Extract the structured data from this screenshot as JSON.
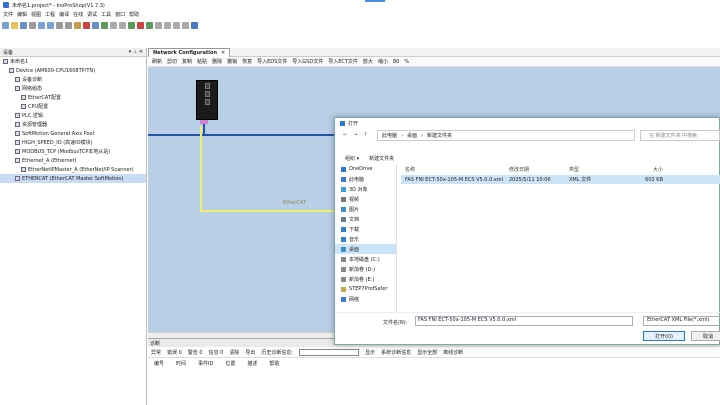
{
  "window": {
    "title": "未命名1.project* - InoProShop(V1.7.3)"
  },
  "menu": [
    "文件",
    "编辑",
    "视图",
    "工程",
    "编译",
    "在线",
    "调试",
    "工具",
    "窗口",
    "帮助"
  ],
  "left_panel": {
    "title": "设备",
    "pin": "▾ ⊥ ✕",
    "tree": [
      {
        "label": "未命名1",
        "indent": 0
      },
      {
        "label": "Device (AM600-CPU1608TP/TN)",
        "indent": 1
      },
      {
        "label": "设备诊断",
        "indent": 2
      },
      {
        "label": "网络组态",
        "indent": 2
      },
      {
        "label": "EtherCAT配置",
        "indent": 3
      },
      {
        "label": "CPU配置",
        "indent": 3
      },
      {
        "label": "PLC 逻辑",
        "indent": 2
      },
      {
        "label": "资源管理器",
        "indent": 2
      },
      {
        "label": "SoftMotion General Axis Pool",
        "indent": 2
      },
      {
        "label": "HIGH_SPEED_IO (高速IO模块)",
        "indent": 2
      },
      {
        "label": "MODBUS_TCP (ModbusTCP本地从站)",
        "indent": 2
      },
      {
        "label": "Ethernet_A (Ethernet)",
        "indent": 2
      },
      {
        "label": "EtherNetIPMaster_A (EtherNet/IP Scanner)",
        "indent": 3
      },
      {
        "label": "ETHERCAT (EtherCAT Master SoftMotion)",
        "indent": 2
      }
    ]
  },
  "tab": {
    "label": "Network Configuration"
  },
  "net_toolbar": [
    "刷新",
    "剪切",
    "复制",
    "粘贴",
    "删除",
    "撤销",
    "恢复",
    "导入EDS文件",
    "导入GSD文件",
    "导入ECT文件",
    "放大",
    "缩小",
    "80",
    "%"
  ],
  "canvas": {
    "ethercat_label": "EtherCAT"
  },
  "diag": {
    "title": "诊断",
    "filters": [
      "异常",
      "错误 0",
      "警告 0",
      "信息 0",
      "清除",
      "导出",
      "历史诊断信息:"
    ],
    "options": [
      "显示",
      "系统诊断信息",
      "显示全部",
      "离线诊断"
    ],
    "columns": [
      "编号",
      "时间",
      "事件ID",
      "位置",
      "描述",
      "帮助"
    ]
  },
  "dialog": {
    "title": "打开",
    "path": [
      "此电脑",
      "桌面",
      "新建文件夹"
    ],
    "search_placeholder": "在 新建文件夹 中搜索",
    "tools": [
      "组织 ▾",
      "新建文件夹"
    ],
    "nav": [
      {
        "label": "OneDrive",
        "icon": "cloud-icon"
      },
      {
        "label": "此电脑",
        "icon": "computer-icon"
      },
      {
        "label": "3D 对象",
        "icon": "3d-icon"
      },
      {
        "label": "视频",
        "icon": "video-icon"
      },
      {
        "label": "图片",
        "icon": "picture-icon"
      },
      {
        "label": "文档",
        "icon": "document-icon"
      },
      {
        "label": "下载",
        "icon": "download-icon"
      },
      {
        "label": "音乐",
        "icon": "music-icon"
      },
      {
        "label": "桌面",
        "icon": "desktop-icon"
      },
      {
        "label": "本地磁盘 (C:)",
        "icon": "drive-icon"
      },
      {
        "label": "新加卷 (D:)",
        "icon": "drive-icon"
      },
      {
        "label": "新加卷 (E:)",
        "icon": "drive-icon"
      },
      {
        "label": "STEP7ProfSafer",
        "icon": "folder-icon"
      },
      {
        "label": "网络",
        "icon": "network-icon"
      }
    ],
    "columns": [
      "名称",
      "修改日期",
      "类型",
      "大小"
    ],
    "file": {
      "name": "FAS FNI ECT-50x-105-M ECS V5.0.0.xml",
      "date": "2025/5/11 10:06",
      "type": "XML 文件",
      "size": "602 KB"
    },
    "filename_label": "文件名(N):",
    "filename_value": "FAS FNI ECT-50x-105-M ECS V5.0.0.xml",
    "filetype": "EtherCAT XML File(*.xml)",
    "open_label": "打开(O)",
    "cancel_label": "取消"
  }
}
